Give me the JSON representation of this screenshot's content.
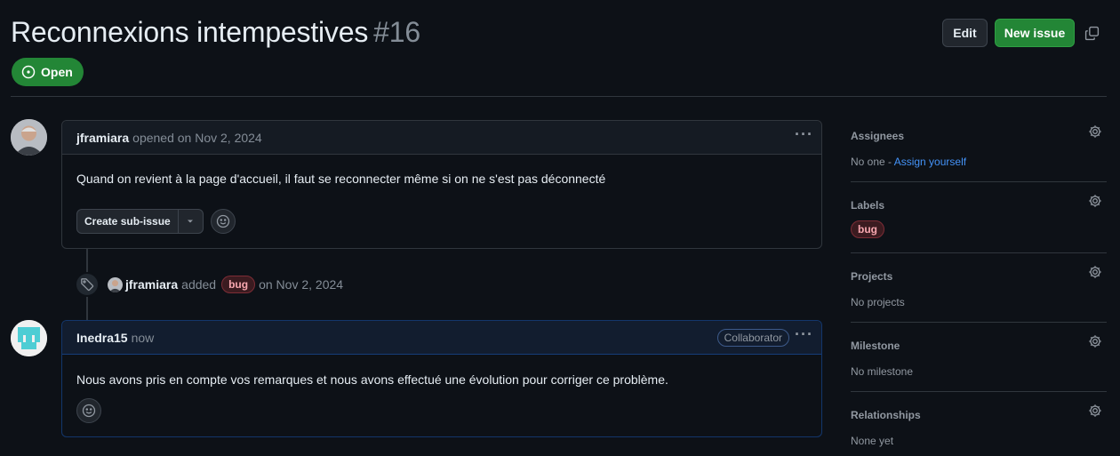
{
  "issue": {
    "title": "Reconnexions intempestives",
    "number": "#16",
    "state": "Open",
    "edit_label": "Edit",
    "new_issue_label": "New issue"
  },
  "comments": [
    {
      "author": "jframiara",
      "meta": "opened on Nov 2, 2024",
      "body": "Quand on revient à la page d'accueil, il faut se reconnecter même si on ne s'est pas déconnecté",
      "sub_issue_label": "Create sub-issue"
    },
    {
      "author": "Inedra15",
      "meta": "now",
      "badge": "Collaborator",
      "body": "Nous avons pris en compte vos remarques et nous avons effectué une évolution pour corriger ce problème."
    }
  ],
  "event": {
    "author": "jframiara",
    "action": "added",
    "label": "bug",
    "date": "on Nov 2, 2024"
  },
  "sidebar": {
    "assignees": {
      "title": "Assignees",
      "value": "No one - ",
      "link": "Assign yourself"
    },
    "labels": {
      "title": "Labels",
      "label": "bug"
    },
    "projects": {
      "title": "Projects",
      "value": "No projects"
    },
    "milestone": {
      "title": "Milestone",
      "value": "No milestone"
    },
    "relationships": {
      "title": "Relationships",
      "value": "None yet"
    }
  },
  "colors": {
    "accent_green": "#238636",
    "link_blue": "#4493f8",
    "bug_label": "#f8a8b0"
  }
}
